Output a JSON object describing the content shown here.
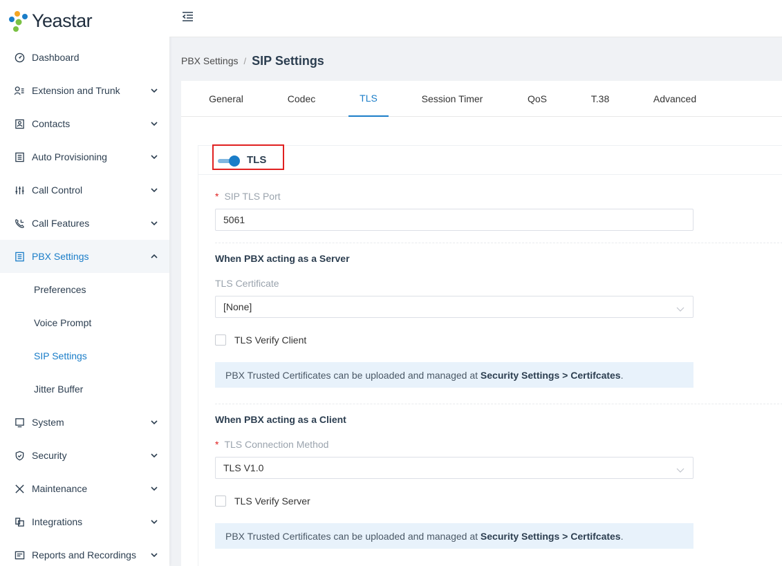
{
  "brand": {
    "name": "Yeastar"
  },
  "sidebar": {
    "items": [
      {
        "label": "Dashboard",
        "icon": "dashboard-icon"
      },
      {
        "label": "Extension and Trunk",
        "icon": "extension-icon"
      },
      {
        "label": "Contacts",
        "icon": "contacts-icon"
      },
      {
        "label": "Auto Provisioning",
        "icon": "provisioning-icon"
      },
      {
        "label": "Call Control",
        "icon": "call-control-icon"
      },
      {
        "label": "Call Features",
        "icon": "call-features-icon"
      },
      {
        "label": "PBX Settings",
        "icon": "pbx-settings-icon"
      },
      {
        "label": "System",
        "icon": "system-icon"
      },
      {
        "label": "Security",
        "icon": "security-icon"
      },
      {
        "label": "Maintenance",
        "icon": "maintenance-icon"
      },
      {
        "label": "Integrations",
        "icon": "integrations-icon"
      },
      {
        "label": "Reports and Recordings",
        "icon": "reports-icon"
      }
    ],
    "pbx_sub": [
      "Preferences",
      "Voice Prompt",
      "SIP Settings",
      "Jitter Buffer"
    ]
  },
  "breadcrumb": {
    "parent": "PBX Settings",
    "sep": "/",
    "current": "SIP Settings"
  },
  "tabs": [
    "General",
    "Codec",
    "TLS",
    "Session Timer",
    "QoS",
    "T.38",
    "Advanced"
  ],
  "active_tab": "TLS",
  "tls": {
    "toggle_label": "TLS",
    "enabled": true,
    "port_label": "SIP TLS Port",
    "port_value": "5061",
    "server_title": "When PBX acting as a Server",
    "cert_label": "TLS Certificate",
    "cert_value": "[None]",
    "verify_client_label": "TLS Verify Client",
    "info_prefix": "PBX Trusted Certificates can be uploaded and managed at ",
    "info_link": "Security Settings > Certifcates",
    "info_suffix": ".",
    "client_title": "When PBX acting as a Client",
    "method_label": "TLS Connection Method",
    "method_value": "TLS V1.0",
    "verify_server_label": "TLS Verify Server"
  },
  "colors": {
    "accent": "#1a7dc8",
    "required": "#e02020",
    "highlight": "#e02020"
  }
}
